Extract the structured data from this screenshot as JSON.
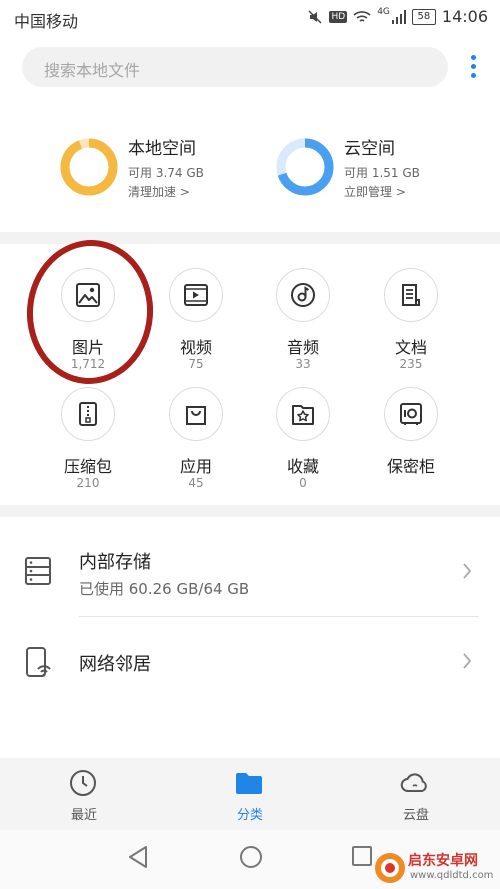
{
  "status_bar": {
    "carrier": "中国移动",
    "network": "4G",
    "battery": "58",
    "time": "14:06"
  },
  "search": {
    "placeholder": "搜索本地文件"
  },
  "storage": {
    "local": {
      "title": "本地空间",
      "available": "可用 3.74 GB",
      "action": "清理加速 >",
      "used_fraction": 0.94,
      "color": "#f5b942"
    },
    "cloud": {
      "title": "云空间",
      "available": "可用 1.51 GB",
      "action": "立即管理 >",
      "used_fraction": 0.7,
      "color": "#4a9ff0"
    }
  },
  "categories": [
    {
      "label": "图片",
      "count": "1,712",
      "icon": "image-icon"
    },
    {
      "label": "视频",
      "count": "75",
      "icon": "video-icon"
    },
    {
      "label": "音频",
      "count": "33",
      "icon": "audio-icon"
    },
    {
      "label": "文档",
      "count": "235",
      "icon": "document-icon"
    },
    {
      "label": "压缩包",
      "count": "210",
      "icon": "archive-icon"
    },
    {
      "label": "应用",
      "count": "45",
      "icon": "app-bag-icon"
    },
    {
      "label": "收藏",
      "count": "0",
      "icon": "favorite-star-icon"
    },
    {
      "label": "保密柜",
      "count": "",
      "icon": "safe-icon"
    }
  ],
  "internal_storage": {
    "title": "内部存储",
    "usage": "已使用 60.26 GB/64 GB"
  },
  "network_neighbor": {
    "title": "网络邻居"
  },
  "bottom_nav": {
    "recent": "最近",
    "category": "分类",
    "cloud": "云盘"
  },
  "watermark": {
    "text": "启东安卓网",
    "url": "www.qdldtd.com"
  },
  "colors": {
    "accent": "#1f86e8",
    "highlight": "#a8201a"
  }
}
